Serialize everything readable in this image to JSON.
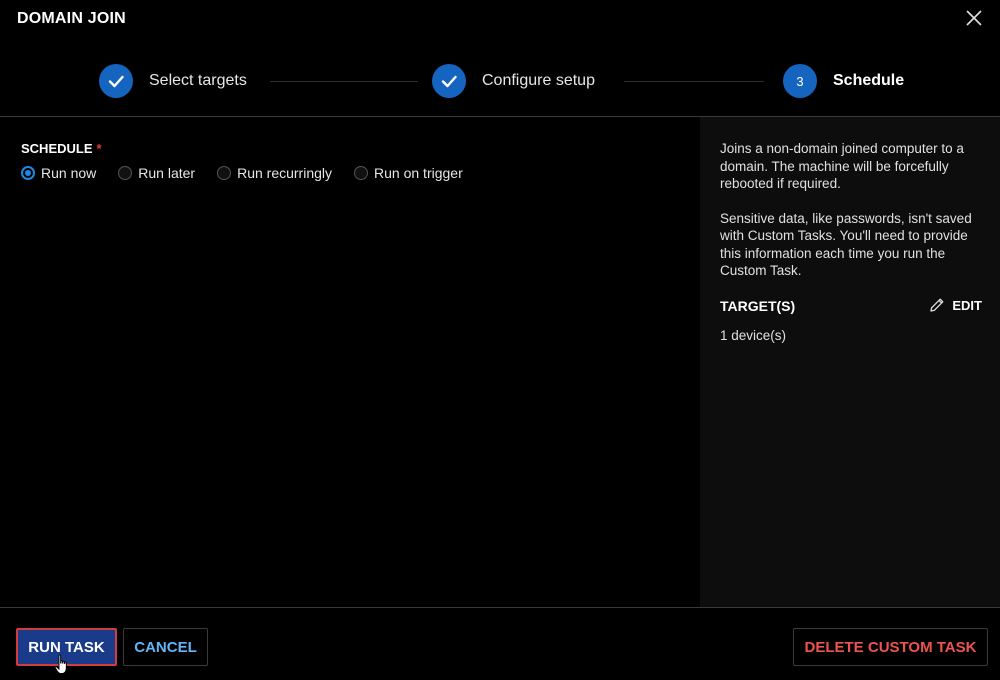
{
  "dialog": {
    "title": "DOMAIN JOIN",
    "close_icon": "close-icon"
  },
  "stepper": {
    "steps": [
      {
        "label": "Select targets",
        "state": "completed",
        "icon": "check-icon"
      },
      {
        "label": "Configure setup",
        "state": "completed",
        "icon": "check-icon"
      },
      {
        "label": "Schedule",
        "state": "active",
        "number": "3"
      }
    ],
    "accent_color": "#1565c0"
  },
  "schedule": {
    "label": "SCHEDULE",
    "required_mark": "*",
    "options": [
      {
        "label": "Run now",
        "selected": true
      },
      {
        "label": "Run later",
        "selected": false
      },
      {
        "label": "Run recurringly",
        "selected": false
      },
      {
        "label": "Run on trigger",
        "selected": false
      }
    ]
  },
  "side_panel": {
    "description": "Joins a non-domain joined computer to a domain. The machine will be forcefully rebooted if required.",
    "note": "Sensitive data, like passwords, isn't saved with Custom Tasks. You'll need to provide this information each time you run the Custom Task.",
    "targets_title": "TARGET(S)",
    "edit_label": "EDIT",
    "edit_icon": "pencil-icon",
    "targets_value": "1 device(s)"
  },
  "footer": {
    "run_label": "RUN TASK",
    "cancel_label": "CANCEL",
    "delete_label": "DELETE CUSTOM TASK"
  },
  "colors": {
    "primary": "#1a3a8a",
    "link": "#64b5f6",
    "danger": "#ef5350",
    "required": "#e53935"
  }
}
